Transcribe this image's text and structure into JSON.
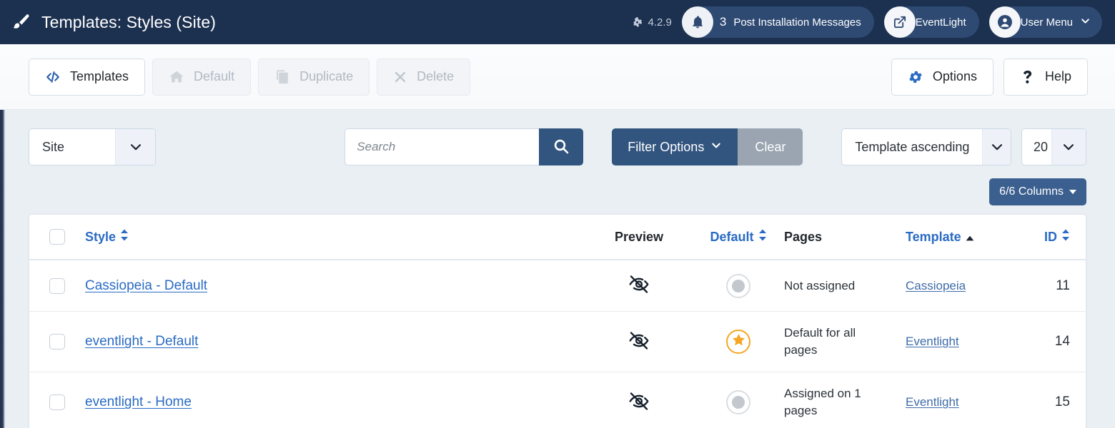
{
  "header": {
    "title": "Templates: Styles (Site)",
    "brand_icon": "paintbrush-icon",
    "version_label": "4.2.9",
    "version_icon": "joomla-logo-icon",
    "messages": {
      "icon": "bell-icon",
      "count": "3",
      "label": "Post Installation Messages"
    },
    "site": {
      "icon": "external-link-icon",
      "label": "EventLight"
    },
    "user": {
      "icon": "user-circle-icon",
      "label": "User Menu",
      "caret": "chevron-down-icon"
    }
  },
  "toolbar": {
    "left": [
      {
        "label": "Templates",
        "icon": "code-brackets-icon",
        "disabled": false
      },
      {
        "label": "Default",
        "icon": "home-icon",
        "disabled": true
      },
      {
        "label": "Duplicate",
        "icon": "copy-icon",
        "disabled": true
      },
      {
        "label": "Delete",
        "icon": "x-icon",
        "disabled": true
      }
    ],
    "right": [
      {
        "label": "Options",
        "icon": "gear-icon"
      },
      {
        "label": "Help",
        "icon": "question-mark-icon"
      }
    ]
  },
  "filters": {
    "client_select": {
      "value": "Site",
      "icon": "chevron-down-icon"
    },
    "search": {
      "value": "",
      "placeholder": "Search",
      "button_icon": "search-icon"
    },
    "filter_options_label": "Filter Options",
    "filter_options_caret": "chevron-down-icon",
    "clear_label": "Clear",
    "ordering_select": {
      "value": "Template ascending",
      "icon": "chevron-down-icon"
    },
    "limit_select": {
      "value": "20",
      "icon": "chevron-down-icon"
    }
  },
  "columns_button": {
    "label": "6/6 Columns",
    "caret": "caret-down-icon"
  },
  "table": {
    "select_all_name": "select-all-checkbox",
    "headers": [
      {
        "key": "check",
        "label": "",
        "sortable": false,
        "sort": "none"
      },
      {
        "key": "style",
        "label": "Style",
        "sortable": true,
        "sort": "none"
      },
      {
        "key": "preview",
        "label": "Preview",
        "sortable": false,
        "sort": "none"
      },
      {
        "key": "default",
        "label": "Default",
        "sortable": true,
        "sort": "none"
      },
      {
        "key": "pages",
        "label": "Pages",
        "sortable": false,
        "sort": "none"
      },
      {
        "key": "template",
        "label": "Template",
        "sortable": true,
        "sort": "asc"
      },
      {
        "key": "id",
        "label": "ID",
        "sortable": true,
        "sort": "none"
      }
    ],
    "rows": [
      {
        "style": "Cassiopeia - Default",
        "preview_icon": "eye-slash-icon",
        "default": false,
        "pages": "Not assigned",
        "template": "Cassiopeia",
        "id": "11"
      },
      {
        "style": "eventlight - Default",
        "preview_icon": "eye-slash-icon",
        "default": true,
        "pages": "Default for all pages",
        "template": "Eventlight",
        "id": "14"
      },
      {
        "style": "eventlight - Home",
        "preview_icon": "eye-slash-icon",
        "default": false,
        "pages": "Assigned on 1 pages",
        "template": "Eventlight",
        "id": "15"
      }
    ]
  },
  "colors": {
    "header_bg": "#1c3050",
    "accent_blue": "#32557f",
    "link_blue": "#2a6bc4",
    "muted_gray": "#9aa5b1",
    "star_orange": "#f5a623",
    "page_bg": "#eaeff4"
  }
}
